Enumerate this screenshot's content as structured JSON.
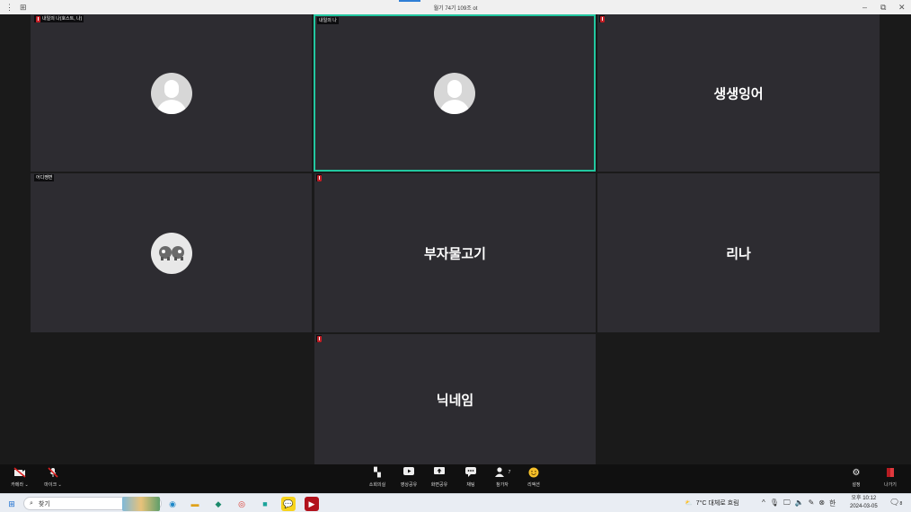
{
  "window": {
    "title": "월기 74기 109조 ot",
    "menu_icon": "dots-icon",
    "layout_icon": "grid-icon"
  },
  "tiles": [
    {
      "label": "내일의 나(호스트, 나)",
      "muted": true,
      "avatar": "default-person",
      "name": ""
    },
    {
      "label": "내일의 나",
      "muted": false,
      "avatar": "default-person",
      "name": "",
      "active": true
    },
    {
      "label": "",
      "muted": true,
      "avatar": "",
      "name": "생생잉어"
    },
    {
      "label": "어디쨍변",
      "muted": false,
      "avatar": "sheep-image",
      "name": ""
    },
    {
      "label": "",
      "muted": true,
      "avatar": "",
      "name": "부자물고기"
    },
    {
      "label": "",
      "muted": false,
      "avatar": "",
      "name": "리나"
    },
    {
      "label": "",
      "muted": true,
      "avatar": "",
      "name": "닉네임"
    }
  ],
  "controls": {
    "camera": "카메라",
    "mic": "마이크",
    "breakout": "소회의실",
    "video_share": "영상공유",
    "screen_share": "화면공유",
    "chat": "채팅",
    "participants": "참가자",
    "participants_count": "7",
    "reaction": "리액션",
    "settings": "설정",
    "leave": "나가기"
  },
  "taskbar": {
    "search_placeholder": "찾기",
    "weather": "7°C  대체로 흐림",
    "time": "오후 10:12",
    "date": "2024-03-05",
    "ime": "한",
    "notif_count": "8"
  }
}
